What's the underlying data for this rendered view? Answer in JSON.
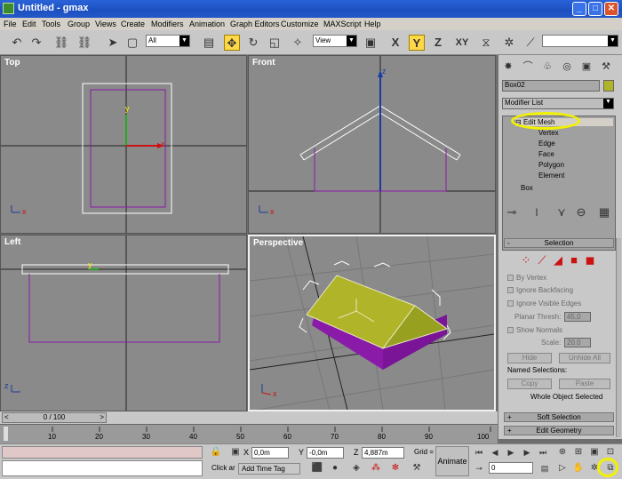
{
  "window": {
    "title": "Untitled - gmax",
    "min": "_",
    "max": "□",
    "close": "✕"
  },
  "menu": [
    "File",
    "Edit",
    "Tools",
    "Group",
    "Views",
    "Create",
    "Modifiers",
    "Animation",
    "Graph Editors",
    "Customize",
    "MAXScript",
    "Help"
  ],
  "toolbar": {
    "selection_filter": "All",
    "ref_coord": "View",
    "axis_x": "X",
    "axis_y": "Y",
    "axis_z": "Z",
    "axis_xy": "XY"
  },
  "viewports": {
    "top": "Top",
    "front": "Front",
    "left": "Left",
    "perspective": "Perspective",
    "axis_x": "x",
    "axis_y": "y",
    "axis_z": "z"
  },
  "command_panel": {
    "object_name": "Box02",
    "modifier_list": "Modifier List",
    "stack": {
      "edit_mesh": "Edit Mesh",
      "vertex": "Vertex",
      "edge": "Edge",
      "face": "Face",
      "polygon": "Polygon",
      "element": "Element",
      "box": "Box"
    },
    "selection": {
      "header": "Selection",
      "by_vertex": "By Vertex",
      "ignore_backfacing": "Ignore Backfacing",
      "ignore_visible_edges": "Ignore Visible Edges",
      "planar_thresh_label": "Planar Thresh:",
      "planar_thresh_value": "45,0",
      "show_normals": "Show Normals",
      "scale_label": "Scale:",
      "scale_value": "20,0",
      "hide": "Hide",
      "unhide_all": "Unhide All",
      "named_selections": "Named Selections:",
      "copy": "Copy",
      "paste": "Paste",
      "whole_object": "Whole Object Selected"
    },
    "soft_selection": "Soft Selection",
    "edit_geometry": "Edit Geometry"
  },
  "timeline": {
    "frame": "0 / 100",
    "ticks": [
      "10",
      "20",
      "30",
      "40",
      "50",
      "60",
      "70",
      "80",
      "90",
      "100"
    ],
    "start": "0",
    "end": "10"
  },
  "status": {
    "click_text": "Click ar",
    "add_time_tag": "Add Time Tag",
    "x_label": "X",
    "x_value": "0,0m",
    "y_label": "Y",
    "y_value": "-0,0m",
    "z_label": "Z",
    "z_value": "4,887m",
    "grid_label": "Grid =",
    "animate": "Animate",
    "frame_value": "0"
  },
  "colors": {
    "mesh": "#b0b428",
    "purple": "#8a1aa8",
    "highlight": "#f2f200"
  }
}
